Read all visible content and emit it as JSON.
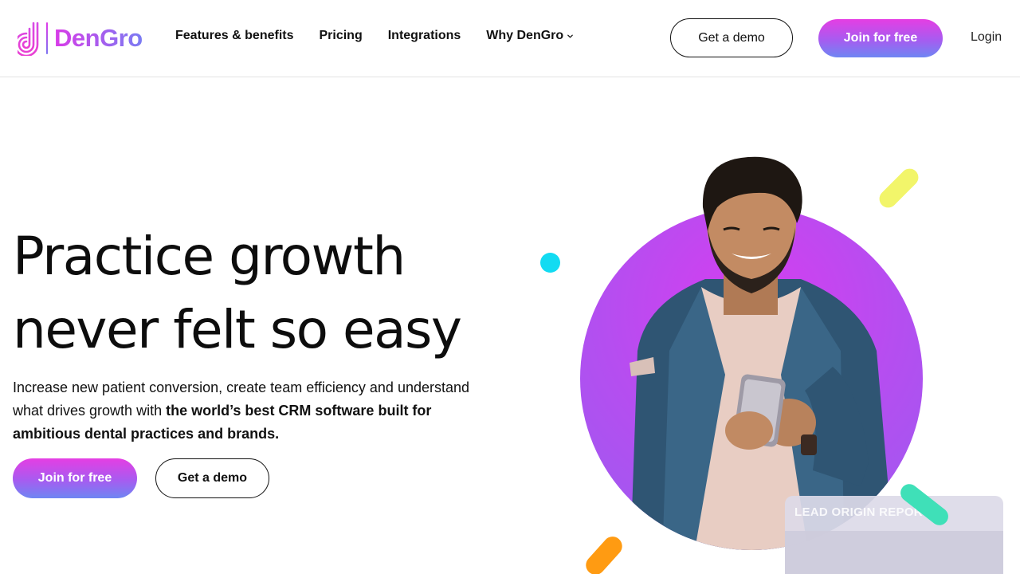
{
  "brand": {
    "name": "DenGro"
  },
  "nav": {
    "items": [
      {
        "label": "Features & benefits"
      },
      {
        "label": "Pricing"
      },
      {
        "label": "Integrations"
      },
      {
        "label": "Why DenGro"
      }
    ]
  },
  "header": {
    "demo_label": "Get a demo",
    "join_label": "Join for free",
    "login_label": "Login"
  },
  "hero": {
    "title_line1": "Practice growth",
    "title_line2": "never felt so easy",
    "subtitle_plain": "Increase new patient conversion, create team efficiency and understand what drives growth with ",
    "subtitle_bold": "the world’s best CRM software built for ambitious dental practices and brands.",
    "join_label": "Join for free",
    "demo_label": "Get a demo"
  },
  "illustration": {
    "report_card_label": "LEAD ORIGIN REPORT"
  },
  "colors": {
    "brand_pink": "#e53ee3",
    "brand_violet": "#6e86f3",
    "accent_cyan": "#12dbf2",
    "accent_yellow": "#f2f56a",
    "accent_teal": "#3fe0b8",
    "accent_orange": "#ff9b12"
  }
}
